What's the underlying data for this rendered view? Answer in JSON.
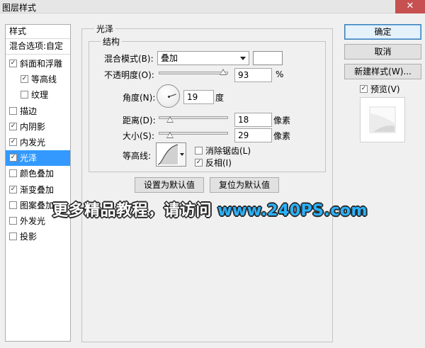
{
  "window": {
    "title": "图层样式",
    "close_glyph": "✕"
  },
  "styles_panel": {
    "header": "样式",
    "blend_options": "混合选项:自定",
    "items": [
      {
        "label": "斜面和浮雕",
        "checked": true,
        "selected": false,
        "indent": false
      },
      {
        "label": "等高线",
        "checked": true,
        "selected": false,
        "indent": true
      },
      {
        "label": "纹理",
        "checked": false,
        "selected": false,
        "indent": true
      },
      {
        "label": "描边",
        "checked": false,
        "selected": false,
        "indent": false
      },
      {
        "label": "内阴影",
        "checked": true,
        "selected": false,
        "indent": false
      },
      {
        "label": "内发光",
        "checked": true,
        "selected": false,
        "indent": false
      },
      {
        "label": "光泽",
        "checked": true,
        "selected": true,
        "indent": false
      },
      {
        "label": "颜色叠加",
        "checked": false,
        "selected": false,
        "indent": false
      },
      {
        "label": "渐变叠加",
        "checked": true,
        "selected": false,
        "indent": false
      },
      {
        "label": "图案叠加",
        "checked": false,
        "selected": false,
        "indent": false
      },
      {
        "label": "外发光",
        "checked": false,
        "selected": false,
        "indent": false
      },
      {
        "label": "投影",
        "checked": false,
        "selected": false,
        "indent": false
      }
    ]
  },
  "satin": {
    "group_title": "光泽",
    "structure_title": "结构",
    "blend_mode_label": "混合模式(B):",
    "blend_mode_value": "叠加",
    "blend_color": "#ffffff",
    "opacity_label": "不透明度(O):",
    "opacity_value": "93",
    "opacity_unit": "%",
    "angle_label": "角度(N):",
    "angle_value": "19",
    "angle_unit": "度",
    "distance_label": "距离(D):",
    "distance_value": "18",
    "distance_unit": "像素",
    "size_label": "大小(S):",
    "size_value": "29",
    "size_unit": "像素",
    "contour_label": "等高线:",
    "anti_alias_label": "消除锯齿(L)",
    "anti_alias_checked": false,
    "invert_label": "反相(I)",
    "invert_checked": true,
    "make_default": "设置为默认值",
    "reset_default": "复位为默认值"
  },
  "buttons": {
    "ok": "确定",
    "cancel": "取消",
    "new_style": "新建样式(W)...",
    "preview_label": "预览(V)",
    "preview_checked": true
  },
  "watermark": {
    "text": "更多精品教程，请访问",
    "url": "www.240PS.com"
  },
  "colors": {
    "selection": "#3399ff",
    "close_button": "#c75050",
    "watermark_url": "#2ab3ff"
  }
}
